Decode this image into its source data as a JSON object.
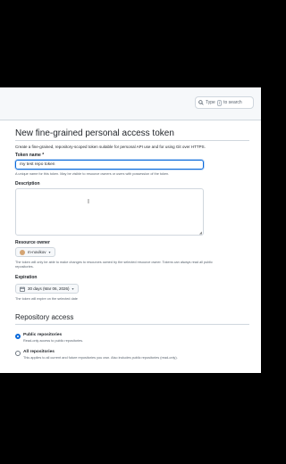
{
  "header": {
    "search_prefix": "Type",
    "search_key": "/",
    "search_suffix": "to search"
  },
  "page": {
    "title": "New fine-grained personal access token",
    "intro": "Create a fine-grained, repository-scoped token suitable for personal API use and for using Git over HTTPS."
  },
  "token_name": {
    "label": "Token name *",
    "value": "my test repo token",
    "help": "A unique name for this token. May be visible to resource owners or users with possession of the token."
  },
  "description": {
    "label": "Description",
    "value": ""
  },
  "resource_owner": {
    "label": "Resource owner",
    "value": "m-novikov",
    "help_line1": "The token will only be able to make changes to resources owned by the selected resource owner. Tokens can always read all public",
    "help_line2": "repositories."
  },
  "expiration": {
    "label": "Expiration",
    "value": "30 days (Mar 06, 2026)",
    "help": "The token will expire on the selected date"
  },
  "repository_access": {
    "title": "Repository access",
    "options": [
      {
        "title": "Public repositories",
        "desc": "Read-only access to public repositories.",
        "selected": true
      },
      {
        "title": "All repositories",
        "desc": "This applies to all current and future repositories you own. Also includes public repositories (read-only).",
        "selected": false
      }
    ]
  }
}
